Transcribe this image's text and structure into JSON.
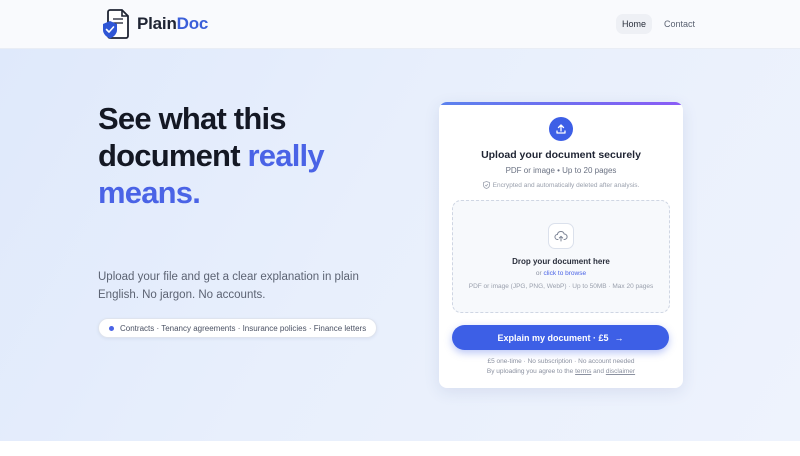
{
  "header": {
    "brand_part1": "Plain",
    "brand_part2": "Doc",
    "nav": [
      {
        "label": "Home",
        "active": true
      },
      {
        "label": "Contact",
        "active": false
      }
    ]
  },
  "hero": {
    "headline_line1": "See what this",
    "headline_line2_a": "document",
    "headline_line2_b": "really",
    "headline_line3": "means.",
    "subtitle": "Upload your file and get a clear explanation in plain English. No jargon. No accounts.",
    "pill_text": "Contracts · Tenancy agreements · Insurance policies · Finance letters"
  },
  "card": {
    "title": "Upload your document securely",
    "subtitle": "PDF or image • Up to 20 pages",
    "secure_note": "Encrypted and automatically deleted after analysis.",
    "dropzone": {
      "title": "Drop your document here",
      "or_text": "or",
      "browse_link": "click to browse",
      "hint": "PDF or image (JPG, PNG, WebP) · Up to 50MB · Max 20 pages"
    },
    "cta_label": "Explain my document · £5",
    "fine_print_1": "£5 one-time · No subscription · No account needed",
    "fine_print_2_a": "By uploading you agree to the",
    "terms_link": "terms",
    "fine_print_2_and": "and",
    "disclaimer_link": "disclaimer"
  },
  "colors": {
    "accent": "#3d5fe6",
    "highlight": "#4a63e6",
    "heading": "#141824"
  },
  "icons": {
    "logo": "document-shield-icon",
    "upload_badge": "upload-icon",
    "dropzone": "cloud-upload-icon",
    "secure": "shield-icon",
    "cta": "arrow-right-icon"
  }
}
